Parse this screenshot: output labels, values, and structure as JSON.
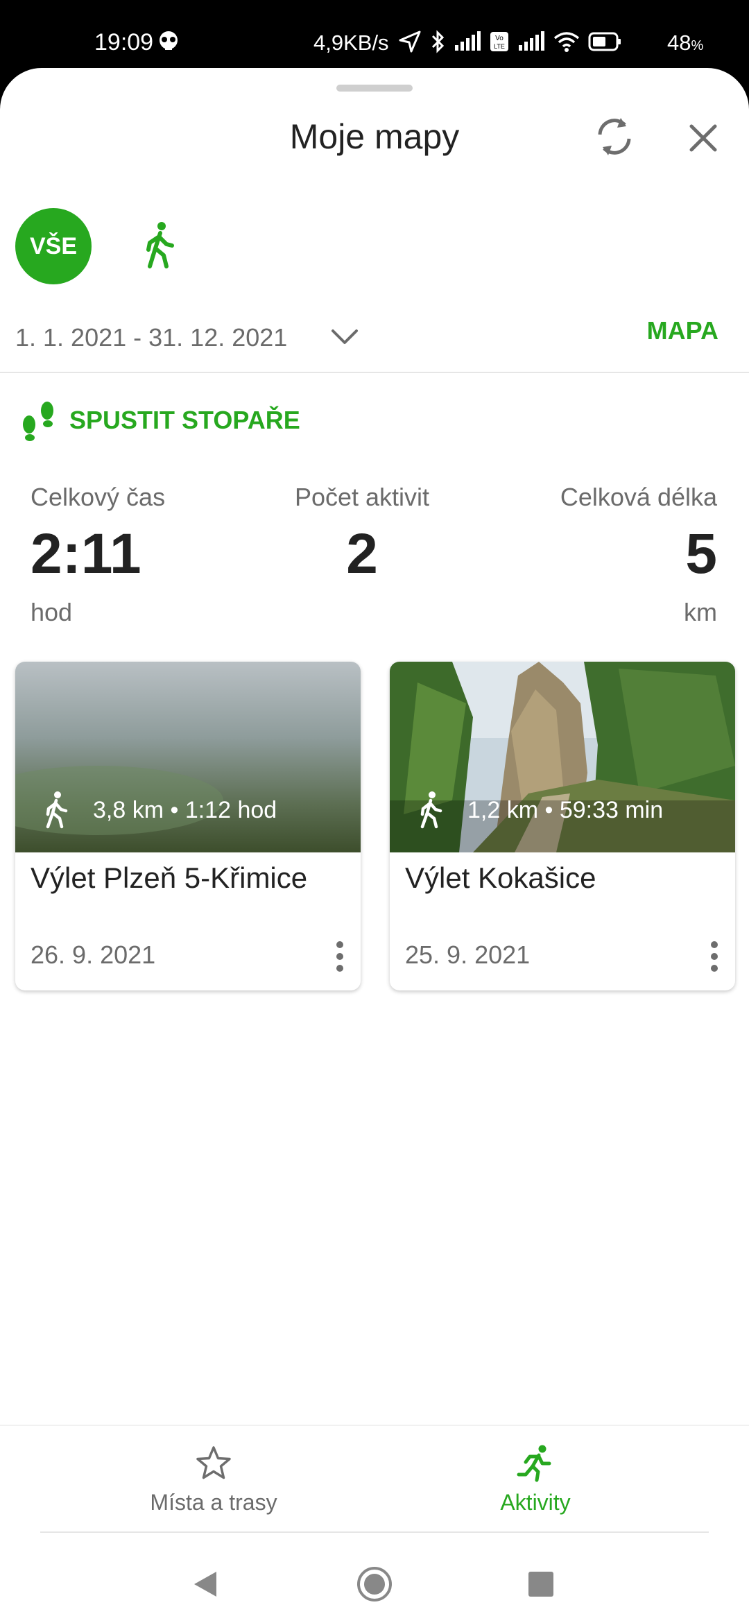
{
  "status_bar": {
    "time": "19:09",
    "speed": "4,9KB/s",
    "battery_percent": "48",
    "battery_unit": "%",
    "icons": [
      "skull-icon",
      "location-arrow-icon",
      "bluetooth-icon",
      "signal-icon",
      "volte-icon",
      "signal-icon",
      "wifi-icon",
      "battery-icon"
    ]
  },
  "header": {
    "title": "Moje mapy",
    "sync_icon": "sync-icon",
    "close_icon": "close-icon"
  },
  "filters": {
    "all_label": "VŠE",
    "walk_icon": "walk-icon"
  },
  "date_filter": {
    "range": "1. 1. 2021 - 31. 12. 2021",
    "map_label": "MAPA"
  },
  "tracker": {
    "label": "SPUSTIT STOPAŘE",
    "icon": "footprints-icon"
  },
  "stats": {
    "total_time_label": "Celkový čas",
    "total_time_value": "2:11",
    "total_time_unit": "hod",
    "activity_count_label": "Počet aktivit",
    "activity_count_value": "2",
    "total_length_label": "Celková délka",
    "total_length_value": "5",
    "total_length_unit": "km"
  },
  "activities": [
    {
      "title": "Výlet Plzeň 5-Křimice",
      "stats": "3,8 km • 1:12 hod",
      "date": "26. 9. 2021"
    },
    {
      "title": "Výlet Kokašice",
      "stats": "1,2 km • 59:33 min",
      "date": "25. 9. 2021"
    }
  ],
  "bottom_nav": {
    "places_label": "Místa a trasy",
    "activities_label": "Aktivity",
    "accent_color": "#27a81f"
  }
}
